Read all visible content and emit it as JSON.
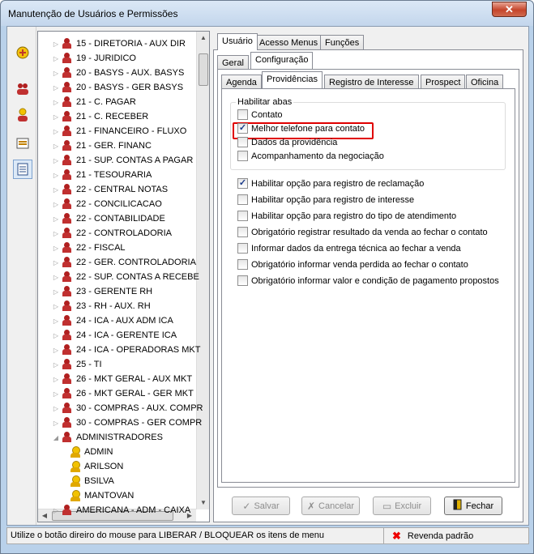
{
  "window": {
    "title": "Manutenção de Usuários e Permissões",
    "close_label": "✕"
  },
  "tree": {
    "items": [
      {
        "label": "15 - DIRETORIA - AUX DIR",
        "type": "group"
      },
      {
        "label": "19 - JURIDICO",
        "type": "group"
      },
      {
        "label": "20 - BASYS - AUX. BASYS",
        "type": "group"
      },
      {
        "label": "20 - BASYS - GER BASYS",
        "type": "group"
      },
      {
        "label": "21 - C. PAGAR",
        "type": "group"
      },
      {
        "label": "21 - C. RECEBER",
        "type": "group"
      },
      {
        "label": "21 - FINANCEIRO - FLUXO",
        "type": "group"
      },
      {
        "label": "21 - GER. FINANC",
        "type": "group"
      },
      {
        "label": "21 - SUP. CONTAS A PAGAR",
        "type": "group"
      },
      {
        "label": "21 - TESOURARIA",
        "type": "group"
      },
      {
        "label": "22 - CENTRAL NOTAS",
        "type": "group"
      },
      {
        "label": "22 - CONCILICACAO",
        "type": "group"
      },
      {
        "label": "22 - CONTABILIDADE",
        "type": "group"
      },
      {
        "label": "22 - CONTROLADORIA",
        "type": "group"
      },
      {
        "label": "22 - FISCAL",
        "type": "group"
      },
      {
        "label": "22 - GER. CONTROLADORIA",
        "type": "group"
      },
      {
        "label": "22 - SUP. CONTAS A RECEBE",
        "type": "group"
      },
      {
        "label": "23 - GERENTE RH",
        "type": "group"
      },
      {
        "label": "23 - RH - AUX. RH",
        "type": "group"
      },
      {
        "label": "24 - ICA - AUX ADM ICA",
        "type": "group"
      },
      {
        "label": "24 - ICA - GERENTE ICA",
        "type": "group"
      },
      {
        "label": "24 - ICA - OPERADORAS MKT",
        "type": "group"
      },
      {
        "label": "25 - TI",
        "type": "group"
      },
      {
        "label": "26 - MKT GERAL - AUX MKT",
        "type": "group"
      },
      {
        "label": "26 - MKT GERAL - GER MKT",
        "type": "group"
      },
      {
        "label": "30 - COMPRAS - AUX. COMPR",
        "type": "group"
      },
      {
        "label": "30 - COMPRAS - GER COMPR",
        "type": "group"
      },
      {
        "label": "ADMINISTRADORES",
        "type": "group-open"
      },
      {
        "label": "ADMIN",
        "type": "user"
      },
      {
        "label": "ARILSON",
        "type": "user"
      },
      {
        "label": "BSILVA",
        "type": "user"
      },
      {
        "label": "MANTOVAN",
        "type": "user"
      },
      {
        "label": "AMERICANA - ADM - CAIXA",
        "type": "group"
      }
    ]
  },
  "tabs_top": [
    {
      "label": "Usuário"
    },
    {
      "label": "Acesso Menus"
    },
    {
      "label": "Funções"
    }
  ],
  "tabs_mid": [
    {
      "label": "Geral"
    },
    {
      "label": "Configuração"
    }
  ],
  "tabs_inner": [
    {
      "label": "Agenda"
    },
    {
      "label": "Providências"
    },
    {
      "label": "Registro de Interesse"
    },
    {
      "label": "Prospect"
    },
    {
      "label": "Oficina"
    }
  ],
  "group": {
    "label": "Habilitar abas",
    "options": [
      {
        "label": "Contato",
        "checked": false
      },
      {
        "label": "Melhor telefone para contato",
        "checked": true
      },
      {
        "label": "Dados da providência",
        "checked": false
      },
      {
        "label": "Acompanhamento da negociação",
        "checked": false
      }
    ]
  },
  "options": [
    {
      "label": "Habilitar opção para registro de reclamação",
      "checked": true
    },
    {
      "label": "Habilitar opção para registro de interesse",
      "checked": false
    },
    {
      "label": "Habilitar opção para registro do tipo de atendimento",
      "checked": false
    },
    {
      "label": "Obrigatório registrar resultado da venda ao fechar o contato",
      "checked": false
    },
    {
      "label": "Informar dados da entrega técnica ao fechar a venda",
      "checked": false
    },
    {
      "label": "Obrigatório informar venda perdida ao fechar o contato",
      "checked": false
    },
    {
      "label": "Obrigatório informar valor e condição de pagamento propostos",
      "checked": false
    }
  ],
  "buttons": {
    "save": "Salvar",
    "cancel": "Cancelar",
    "delete": "Excluir",
    "close": "Fechar"
  },
  "status": {
    "message": "Utilize o botão direiro do mouse para LIBERAR / BLOQUEAR os itens de menu",
    "revenda": "Revenda padrão"
  }
}
